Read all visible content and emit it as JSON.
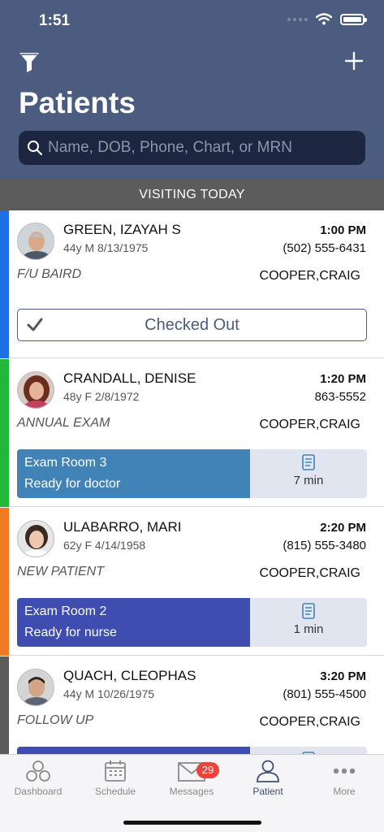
{
  "status": {
    "time": "1:51"
  },
  "header": {
    "title": "Patients",
    "search_placeholder": "Name, DOB, Phone, Chart, or MRN"
  },
  "section_title": "VISITING TODAY",
  "colors": {
    "header": "#4b5c80",
    "bar_blue": "#1f6fe5",
    "bar_green": "#21b83a",
    "bar_orange": "#f07b22",
    "bar_gray": "#5c5c5c",
    "room_teal": "#4283b7",
    "room_indigo": "#3f4db1"
  },
  "patients": [
    {
      "name": "GREEN, IZAYAH S",
      "demographics": "44y M 8/13/1975",
      "time": "1:00 PM",
      "phone": "(502) 555-6431",
      "reason": "F/U BAIRD",
      "provider": "COOPER,CRAIG",
      "status_button": "Checked Out"
    },
    {
      "name": "CRANDALL, DENISE",
      "demographics": "48y F 2/8/1972",
      "time": "1:20 PM",
      "phone": "863-5552",
      "reason": "ANNUAL EXAM",
      "provider": "COOPER,CRAIG",
      "room": "Exam Room 3",
      "room_status": "Ready for doctor",
      "wait": "7 min"
    },
    {
      "name": "ULABARRO, MARI",
      "demographics": "62y F 4/14/1958",
      "time": "2:20 PM",
      "phone": "(815) 555-3480",
      "reason": "NEW PATIENT",
      "provider": "COOPER,CRAIG",
      "room": "Exam Room 2",
      "room_status": "Ready for nurse",
      "wait": "1 min"
    },
    {
      "name": "QUACH, CLEOPHAS",
      "demographics": "44y M 10/26/1975",
      "time": "3:20 PM",
      "phone": "(801) 555-4500",
      "reason": "FOLLOW UP",
      "provider": "COOPER,CRAIG"
    }
  ],
  "tabs": [
    {
      "label": "Dashboard",
      "icon": "dashboard-icon"
    },
    {
      "label": "Schedule",
      "icon": "calendar-icon"
    },
    {
      "label": "Messages",
      "icon": "envelope-icon",
      "badge": "29"
    },
    {
      "label": "Patient",
      "icon": "person-icon",
      "active": true
    },
    {
      "label": "More",
      "icon": "more-icon"
    }
  ]
}
